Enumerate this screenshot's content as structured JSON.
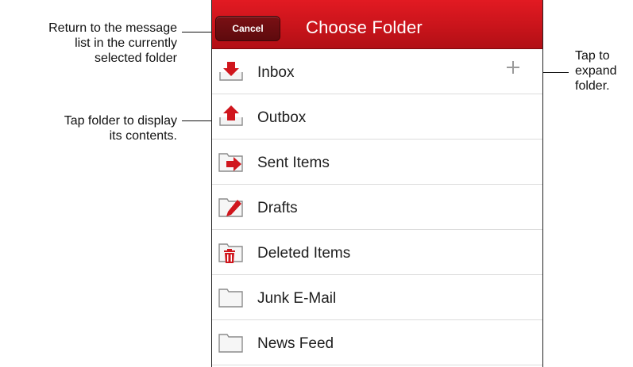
{
  "callouts": {
    "cancel": [
      "Return to the message",
      "list in the currently",
      "selected folder"
    ],
    "tap_folder": [
      "Tap folder to display",
      "its contents."
    ],
    "expand": [
      "Tap to",
      "expand",
      "folder."
    ]
  },
  "navbar": {
    "cancel_label": "Cancel",
    "title": "Choose Folder"
  },
  "folders": [
    {
      "label": "Inbox",
      "icon": "inbox-icon",
      "expandable": true
    },
    {
      "label": "Outbox",
      "icon": "outbox-icon"
    },
    {
      "label": "Sent Items",
      "icon": "sent-items-icon"
    },
    {
      "label": "Drafts",
      "icon": "drafts-icon"
    },
    {
      "label": "Deleted Items",
      "icon": "deleted-items-icon"
    },
    {
      "label": "Junk E-Mail",
      "icon": "folder-icon"
    },
    {
      "label": "News Feed",
      "icon": "folder-icon"
    }
  ],
  "colors": {
    "accent": "#d0161d",
    "folder_outline": "#8c8c8c"
  }
}
